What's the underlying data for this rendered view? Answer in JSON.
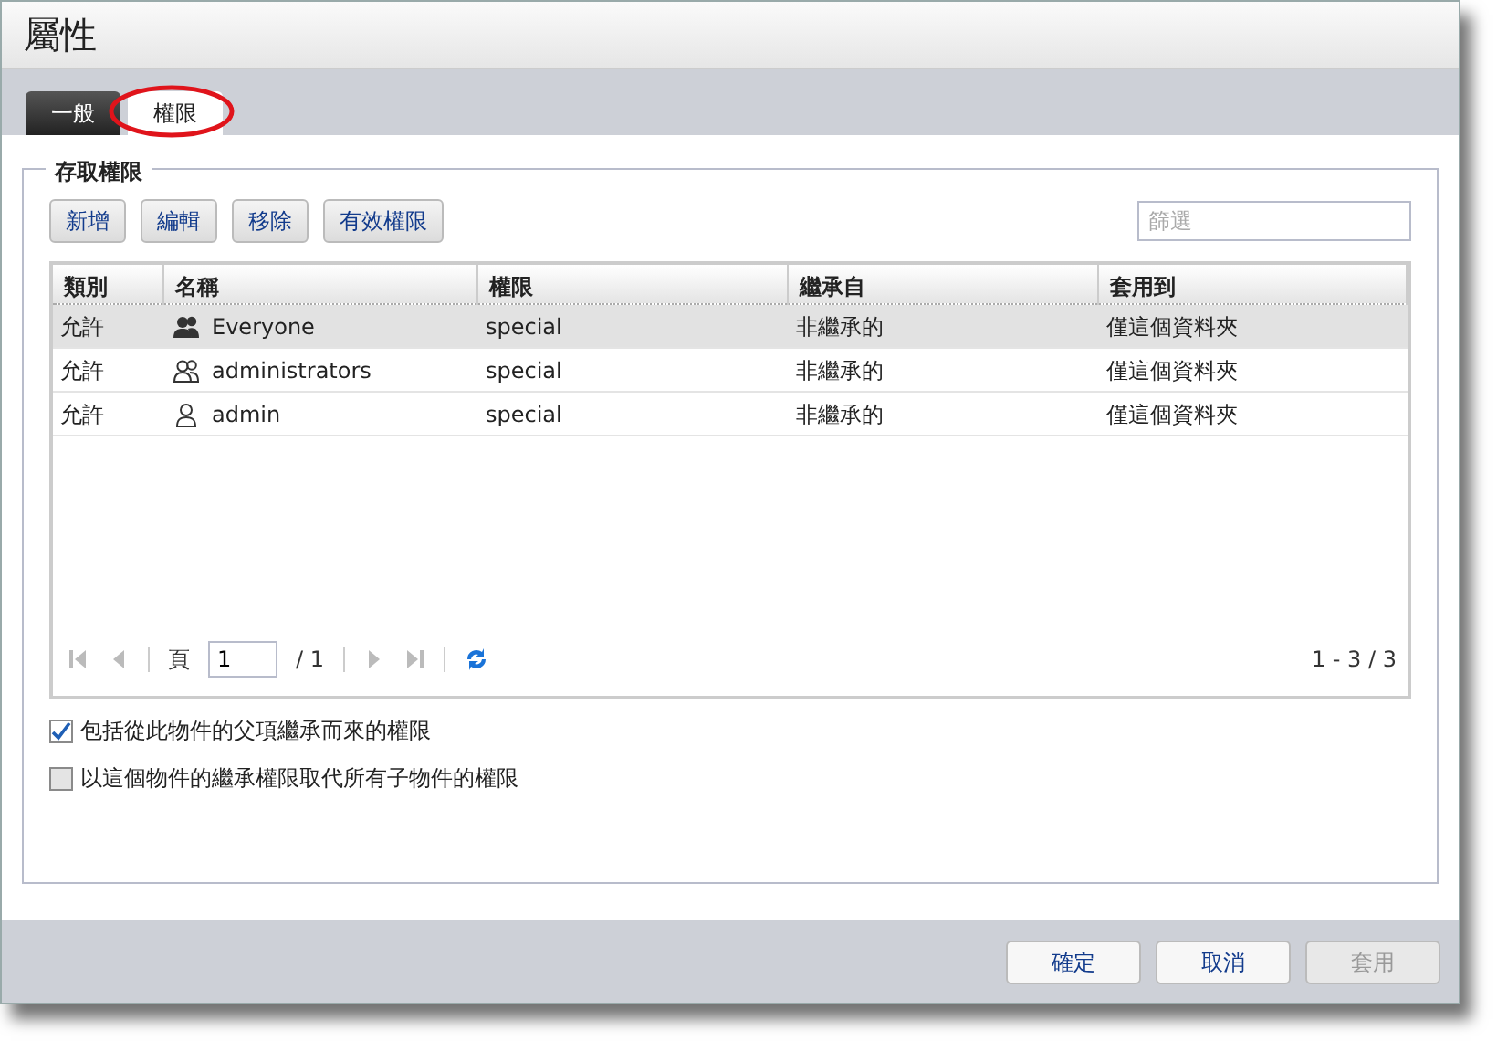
{
  "window": {
    "title": "屬性"
  },
  "tabs": [
    {
      "label": "一般",
      "selected": false,
      "circled": false
    },
    {
      "label": "權限",
      "selected": true,
      "circled": true
    }
  ],
  "section": {
    "legend": "存取權限"
  },
  "toolbar": [
    {
      "label": "新增"
    },
    {
      "label": "編輯"
    },
    {
      "label": "移除"
    },
    {
      "label": "有效權限"
    }
  ],
  "filter": {
    "placeholder": "篩選"
  },
  "table": {
    "columns": [
      "類別",
      "名稱",
      "權限",
      "繼承自",
      "套用到"
    ],
    "rows": [
      {
        "selected": true,
        "kind": "everyone",
        "cells": [
          "允許",
          "Everyone",
          "special",
          "非繼承的",
          "僅這個資料夾"
        ]
      },
      {
        "selected": false,
        "kind": "group",
        "cells": [
          "允許",
          "administrators",
          "special",
          "非繼承的",
          "僅這個資料夾"
        ]
      },
      {
        "selected": false,
        "kind": "user",
        "cells": [
          "允許",
          "admin",
          "special",
          "非繼承的",
          "僅這個資料夾"
        ]
      }
    ]
  },
  "pager": {
    "page_label": "頁",
    "page": "1",
    "total": "/ 1",
    "range": "1 - 3 / 3"
  },
  "options": [
    {
      "label": "包括從此物件的父項繼承而來的權限",
      "checked": true
    },
    {
      "label": "以這個物件的繼承權限取代所有子物件的權限",
      "checked": false
    }
  ],
  "buttons": [
    {
      "label": "確定",
      "disabled": false
    },
    {
      "label": "取消",
      "disabled": false
    },
    {
      "label": "套用",
      "disabled": true
    }
  ]
}
